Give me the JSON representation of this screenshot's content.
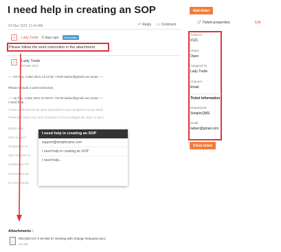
{
  "ticket": {
    "title": "I need help in creating an SOP",
    "date": "03 Mar 2021 11:40 AM",
    "reply_label": "Reply",
    "comment_label": "Comment"
  },
  "message": {
    "avatar": "LT",
    "author": "Lady Trede",
    "age": "6 days ago",
    "badge": "Resolution",
    "body": "Please follow the work instruction in the attachment"
  },
  "reply": {
    "avatar": "LT",
    "author": "Lady Trede",
    "date": "03 Mar 2021",
    "lines": [
      "---- On  Thu, 4 Mar 2021 13:12:52 +0100 ladser@gmail.com  wrote ----",
      "Please include a work instruction",
      "---- on  Thu, 4 Mar 2021 01:08:07 +01:00 ladser@gmail.com  wrote ----",
      "I need help..."
    ],
    "faded_lines": [
      "I have confirmed funds were deposited to your recipient's Union Bank",
      "Powersen Jotex Hej Lady Cheysser Vi har modtaget din retur! Vi har v",
      "Radar now -",
      "Here is your f",
      "Shopping in w",
      "ady Cheysser D",
      "rusalangan-Tre",
      "to know this ab",
      "ve successfully"
    ]
  },
  "popup": {
    "title": "I need help in creating an SOP",
    "email": "support@simplerqms.com",
    "subject": "I need help in creating an SOP",
    "body": "I need help..."
  },
  "attachments": {
    "title": "Attachments :",
    "file_name": "REC060-107-2 WI 060.07 Working with Change Requests.docx",
    "file_size": "230 KB"
  },
  "sidebar": {
    "add_ticket": "Add ticket",
    "properties_title": "Ticket properties",
    "edit": "Edit",
    "ticket_id_label": "Ticket Id",
    "ticket_id": "#121",
    "status_label": "Status",
    "status": "Open",
    "assigned_label": "Assigned To",
    "assigned": "Lady Trede",
    "channel_label": "Channel",
    "channel": "Email",
    "info_title": "Ticket Information",
    "department_label": "Department",
    "department": "SimplerQMS",
    "email_label": "Email",
    "email": "ladser@gmail.com",
    "close_ticket": "Close ticket"
  },
  "colors": {
    "accent": "#f07d3c",
    "highlight": "#e0303a",
    "badge": "#4f9bd6"
  }
}
